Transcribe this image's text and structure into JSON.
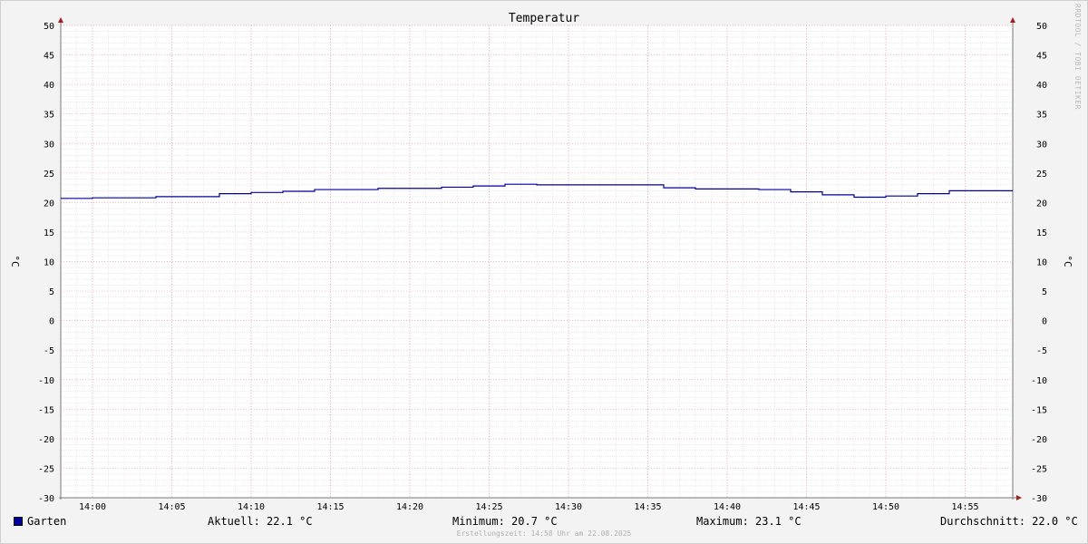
{
  "chart_data": {
    "type": "line",
    "title": "Temperatur",
    "ylabel": "°C",
    "ylabel_right": "°C",
    "ylim": [
      -30,
      50
    ],
    "yticks": [
      50,
      45,
      40,
      35,
      30,
      25,
      20,
      15,
      10,
      5,
      0,
      -5,
      -10,
      -15,
      -20,
      -25,
      -30
    ],
    "xlim": [
      "13:58",
      "14:58"
    ],
    "xticks": [
      "14:00",
      "14:05",
      "14:10",
      "14:15",
      "14:20",
      "14:25",
      "14:30",
      "14:35",
      "14:40",
      "14:45",
      "14:50",
      "14:55"
    ],
    "grid": true,
    "series": [
      {
        "name": "Garten",
        "color": "#00009f",
        "step": true,
        "x": [
          "13:58",
          "14:00",
          "14:04",
          "14:08",
          "14:10",
          "14:12",
          "14:14",
          "14:18",
          "14:22",
          "14:24",
          "14:26",
          "14:28",
          "14:32",
          "14:36",
          "14:38",
          "14:42",
          "14:44",
          "14:46",
          "14:48",
          "14:50",
          "14:52",
          "14:54",
          "14:58"
        ],
        "values": [
          20.7,
          20.8,
          21.0,
          21.5,
          21.7,
          21.9,
          22.2,
          22.4,
          22.6,
          22.8,
          23.1,
          23.0,
          23.0,
          22.5,
          22.3,
          22.2,
          21.8,
          21.3,
          20.9,
          21.1,
          21.5,
          22.0,
          22.0
        ]
      }
    ]
  },
  "legend": {
    "series_name": "Garten",
    "series_color": "#00009f",
    "current": "Aktuell: 22.1 °C",
    "minimum": "Minimum: 20.7 °C",
    "maximum": "Maximum: 23.1 °C",
    "average": "Durchschnitt: 22.0 °C"
  },
  "footer": {
    "created": "Erstellungszeit: 14:58 Uhr am 22.08.2025"
  },
  "watermark": "RRDTOOL / TOBI OETIKER"
}
